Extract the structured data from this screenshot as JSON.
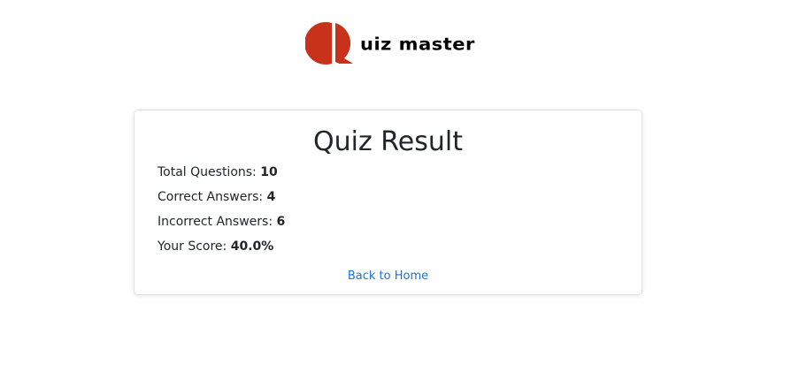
{
  "brand": {
    "logo_letter": "Q",
    "logo_text": "uiz master",
    "logo_color": "#c8321a"
  },
  "result": {
    "title": "Quiz Result",
    "stats": [
      {
        "label": "Total Questions:",
        "value": "10"
      },
      {
        "label": "Correct Answers:",
        "value": "4"
      },
      {
        "label": "Incorrect Answers:",
        "value": "6"
      },
      {
        "label": "Your Score:",
        "value": "40.0%"
      }
    ],
    "back_link": "Back to Home"
  },
  "colors": {
    "link": "#1a73d9",
    "text": "#212529",
    "card_border": "#e2e2e2"
  }
}
